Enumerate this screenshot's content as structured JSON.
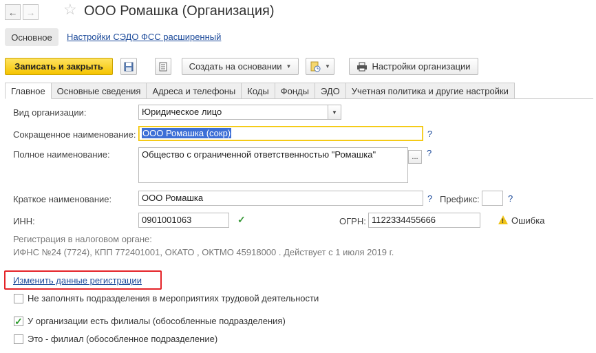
{
  "window": {
    "title": "ООО Ромашка (Организация)",
    "nav_back": "←",
    "nav_forward": "→",
    "star": "☆"
  },
  "sections": {
    "active": "Основное",
    "link": "Настройки СЭДО ФСС расширенный"
  },
  "toolbar": {
    "save_close": "Записать и закрыть",
    "create_based": "Создать на основании",
    "org_settings": "Настройки организации"
  },
  "tabs": [
    "Главное",
    "Основные сведения",
    "Адреса и телефоны",
    "Коды",
    "Фонды",
    "ЭДО",
    "Учетная политика и другие настройки"
  ],
  "form": {
    "org_type_label": "Вид организации:",
    "org_type_value": "Юридическое лицо",
    "short_name_label": "Сокращенное наименование:",
    "short_name_value": "ООО Ромашка (сокр)",
    "full_name_label": "Полное наименование:",
    "full_name_value": "Общество с ограниченной ответственностью \"Ромашка\"",
    "brief_name_label": "Краткое наименование:",
    "brief_name_value": "ООО Ромашка",
    "prefix_label": "Префикс:",
    "prefix_value": "",
    "inn_label": "ИНН:",
    "inn_value": "0901001063",
    "ogrn_label": "ОГРН:",
    "ogrn_value": "1122334455666",
    "error_text": "Ошибка",
    "qmark": "?",
    "ellipsis": "...",
    "tax_reg_label": "Регистрация в налоговом органе:",
    "tax_reg_value": "ИФНС №24 (7724), КПП 772401001, ОКАТО , ОКТМО 45918000   . Действует с 1 июля 2019 г.",
    "change_reg_link": "Изменить данные регистрации"
  },
  "checkboxes": [
    {
      "label": "Не заполнять подразделения в мероприятиях трудовой деятельности",
      "checked": false
    },
    {
      "label": "У организации есть филиалы (обособленные подразделения)",
      "checked": true
    },
    {
      "label": "Это - филиал (обособленное подразделение)",
      "checked": false
    }
  ]
}
